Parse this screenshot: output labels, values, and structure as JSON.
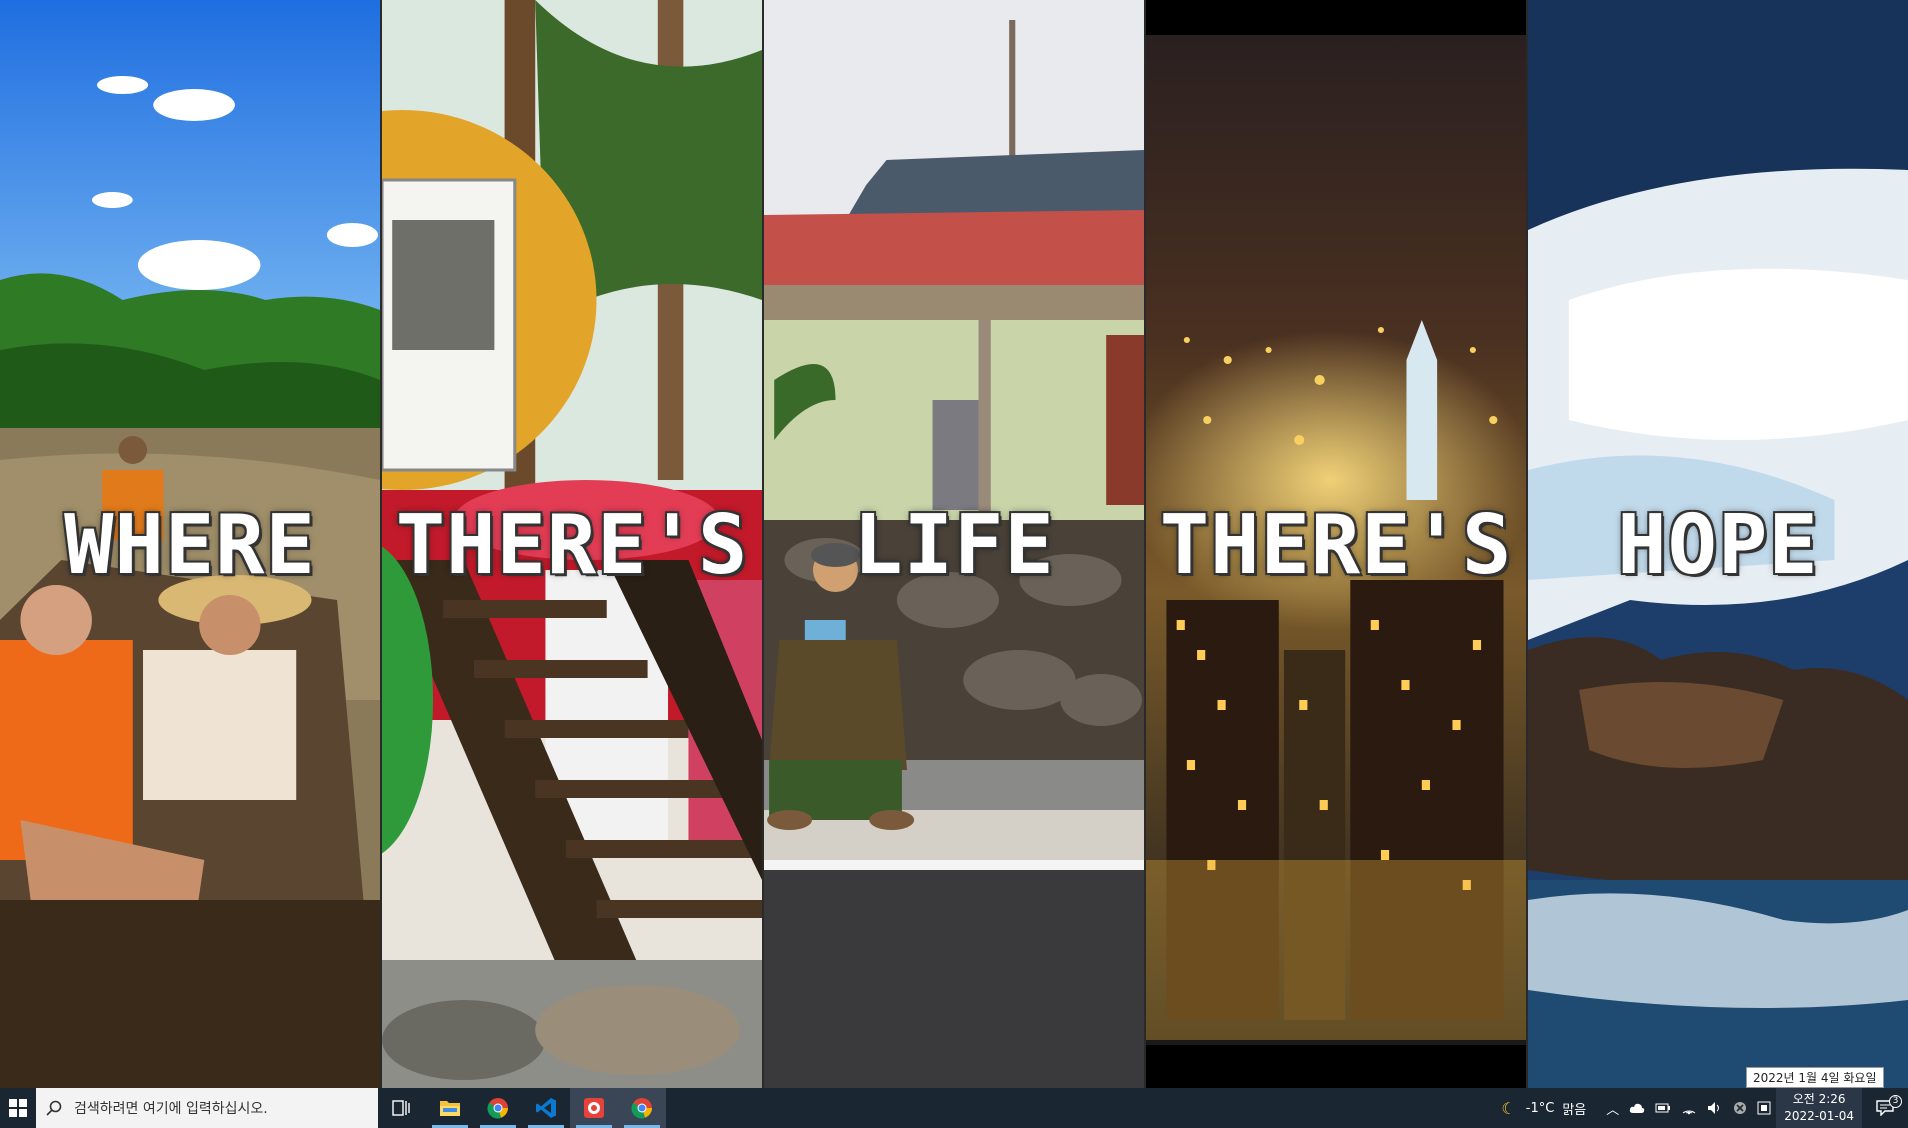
{
  "wallpaper": {
    "words": [
      "WHERE",
      "THERE'S",
      "LIFE",
      "THERE'S",
      "HOPE"
    ]
  },
  "taskbar": {
    "search_placeholder": "검색하려면 여기에 입력하십시오.",
    "apps": [
      {
        "name": "File Explorer",
        "icon": "folder-icon"
      },
      {
        "name": "Chrome",
        "icon": "chrome-icon"
      },
      {
        "name": "Visual Studio Code",
        "icon": "vscode-icon"
      },
      {
        "name": "App",
        "icon": "app-icon"
      },
      {
        "name": "Chrome",
        "icon": "chrome-icon"
      }
    ],
    "tray": {
      "weather_temp": "-1°C",
      "weather_desc": "맑음",
      "time": "오전 2:26",
      "date": "2022-01-04",
      "date_tooltip": "2022년 1월 4일 화요일",
      "notification_count": "3"
    }
  },
  "colors": {
    "taskbar_bg": "#1b2633",
    "accent": "#76b9ed"
  }
}
